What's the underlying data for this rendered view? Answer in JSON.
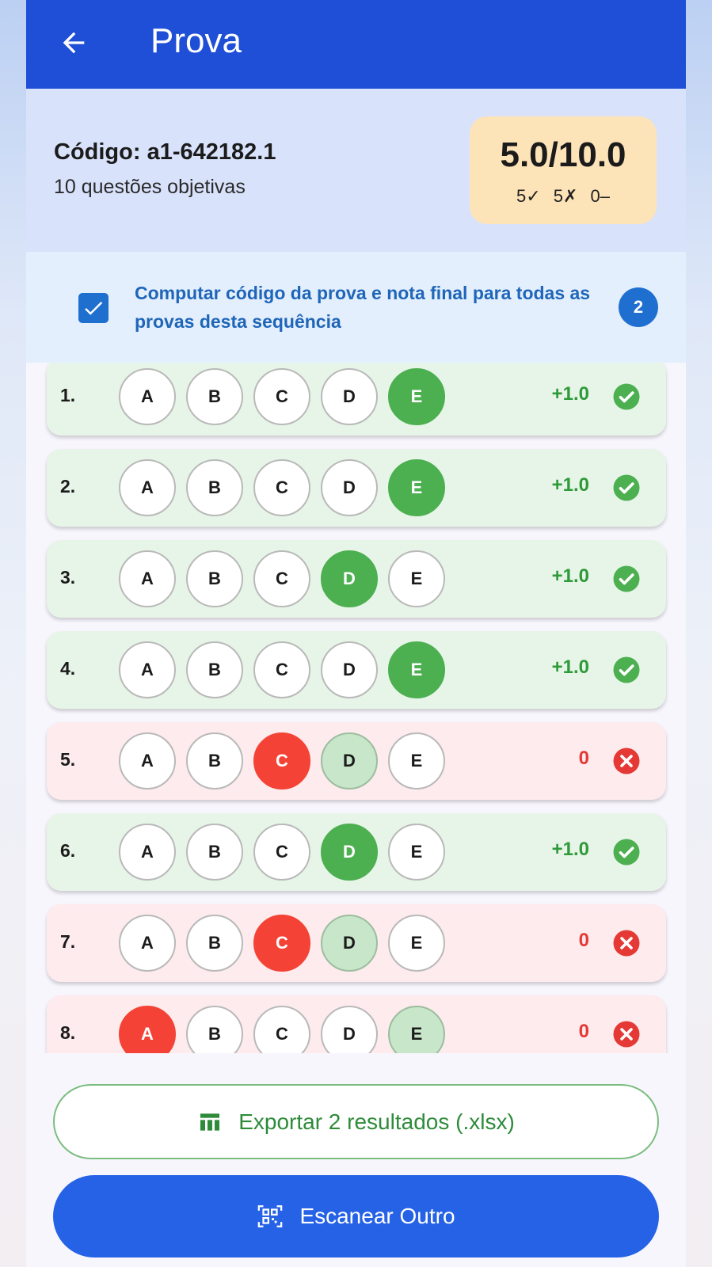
{
  "header": {
    "title": "Prova",
    "back_icon": "arrow-left-icon"
  },
  "summary": {
    "code": "Código: a1-642182.1",
    "subtitle": "10 questões objetivas",
    "score": "5.0/10.0",
    "correct_count": "5✓",
    "wrong_count": "5✗",
    "blank_count": "0–"
  },
  "sequence": {
    "checked": true,
    "text": "Computar código da prova e nota final para todas as provas desta sequência",
    "badge": "2"
  },
  "colors": {
    "appbar": "#1e4fd6",
    "correct": "#4caf50",
    "wrong": "#f44336",
    "answer_key": "#c8e6c9",
    "score_box": "#fde3b8"
  },
  "questions": [
    {
      "number": "1.",
      "options": [
        "A",
        "B",
        "C",
        "D",
        "E"
      ],
      "selected": "E",
      "answer": "E",
      "points": "+1.0",
      "status": "correct"
    },
    {
      "number": "2.",
      "options": [
        "A",
        "B",
        "C",
        "D",
        "E"
      ],
      "selected": "E",
      "answer": "E",
      "points": "+1.0",
      "status": "correct"
    },
    {
      "number": "3.",
      "options": [
        "A",
        "B",
        "C",
        "D",
        "E"
      ],
      "selected": "D",
      "answer": "D",
      "points": "+1.0",
      "status": "correct"
    },
    {
      "number": "4.",
      "options": [
        "A",
        "B",
        "C",
        "D",
        "E"
      ],
      "selected": "E",
      "answer": "E",
      "points": "+1.0",
      "status": "correct"
    },
    {
      "number": "5.",
      "options": [
        "A",
        "B",
        "C",
        "D",
        "E"
      ],
      "selected": "C",
      "answer": "D",
      "points": "0",
      "status": "wrong"
    },
    {
      "number": "6.",
      "options": [
        "A",
        "B",
        "C",
        "D",
        "E"
      ],
      "selected": "D",
      "answer": "D",
      "points": "+1.0",
      "status": "correct"
    },
    {
      "number": "7.",
      "options": [
        "A",
        "B",
        "C",
        "D",
        "E"
      ],
      "selected": "C",
      "answer": "D",
      "points": "0",
      "status": "wrong"
    },
    {
      "number": "8.",
      "options": [
        "A",
        "B",
        "C",
        "D",
        "E"
      ],
      "selected": "A",
      "answer": "E",
      "points": "0",
      "status": "wrong"
    }
  ],
  "actions": {
    "export_label": "Exportar 2 resultados (.xlsx)",
    "export_icon": "table-icon",
    "scan_label": "Escanear Outro",
    "scan_icon": "qr-code-scanner-icon"
  }
}
